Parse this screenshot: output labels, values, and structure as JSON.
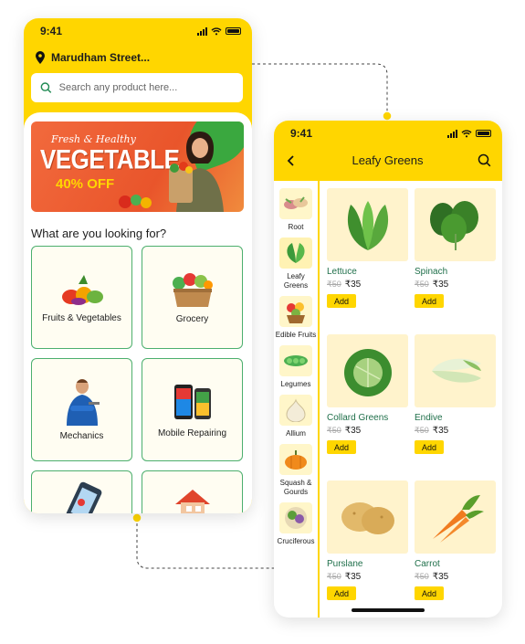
{
  "colors": {
    "brand_yellow": "#ffd600",
    "accent_green": "#4caf6e",
    "price_green": "#1f6f4a"
  },
  "home": {
    "status_time": "9:41",
    "location": "Marudham Street...",
    "search_placeholder": "Search any product here...",
    "banner": {
      "line1": "Fresh & Healthy",
      "line2": "VEGETABLE",
      "line3": "40% OFF"
    },
    "section_title": "What are you looking for?",
    "categories": [
      {
        "label": "Fruits & Vegetables",
        "icon": "fruits-vegetables-icon"
      },
      {
        "label": "Grocery",
        "icon": "grocery-box-icon"
      },
      {
        "label": "Mechanics",
        "icon": "mechanic-icon"
      },
      {
        "label": "Mobile Repairing",
        "icon": "mobile-phone-icon"
      },
      {
        "label": "",
        "icon": "phone-map-icon"
      },
      {
        "label": "",
        "icon": "house-icon"
      }
    ]
  },
  "listing": {
    "status_time": "9:41",
    "title": "Leafy Greens",
    "sidebar": [
      {
        "label": "Root"
      },
      {
        "label": "Leafy Greens"
      },
      {
        "label": "Edible Fruits"
      },
      {
        "label": "Legumes"
      },
      {
        "label": "Allium"
      },
      {
        "label": "Squash & Gourds"
      },
      {
        "label": "Cruciferous"
      }
    ],
    "products": [
      {
        "name": "Lettuce",
        "old_price": "₹50",
        "price": "₹35",
        "add": "Add"
      },
      {
        "name": "Spinach",
        "old_price": "₹50",
        "price": "₹35",
        "add": "Add"
      },
      {
        "name": "Collard Greens",
        "old_price": "₹50",
        "price": "₹35",
        "add": "Add"
      },
      {
        "name": "Endive",
        "old_price": "₹50",
        "price": "₹35",
        "add": "Add"
      },
      {
        "name": "Purslane",
        "old_price": "₹50",
        "price": "₹35",
        "add": "Add"
      },
      {
        "name": "Carrot",
        "old_price": "₹50",
        "price": "₹35",
        "add": "Add"
      }
    ]
  }
}
